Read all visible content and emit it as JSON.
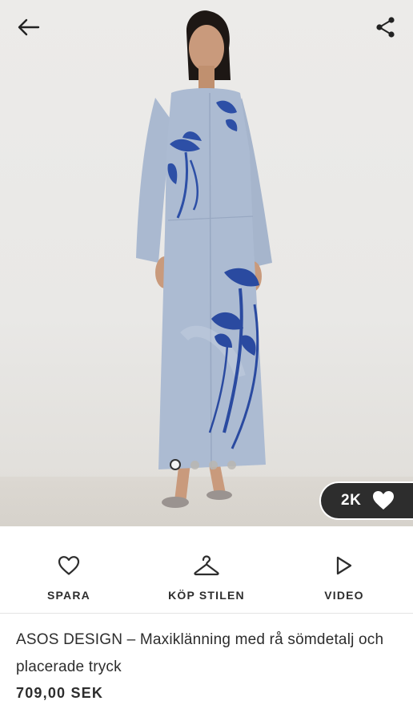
{
  "gallery": {
    "image_alt": "Model wearing a light blue maxi dress with a dark blue floral print",
    "dots": 4,
    "active_dot": 1,
    "likes": "2K"
  },
  "icons": {
    "back": "arrow-left-icon",
    "share": "share-icon",
    "like": "heart-filled-icon",
    "save": "heart-outline-icon",
    "shop_look": "hanger-icon",
    "video": "play-outline-icon"
  },
  "actions": {
    "save_label": "SPARA",
    "shop_look_label": "KÖP STILEN",
    "video_label": "VIDEO"
  },
  "product": {
    "title": "ASOS DESIGN – Maxiklänning med rå sömdetalj och placerade tryck",
    "price": "709,00 SEK"
  },
  "colors": {
    "text": "#2d2d2d",
    "badge_bg": "#2d2d2d",
    "dress": "#a9b8cf",
    "print": "#2a4aa0"
  }
}
